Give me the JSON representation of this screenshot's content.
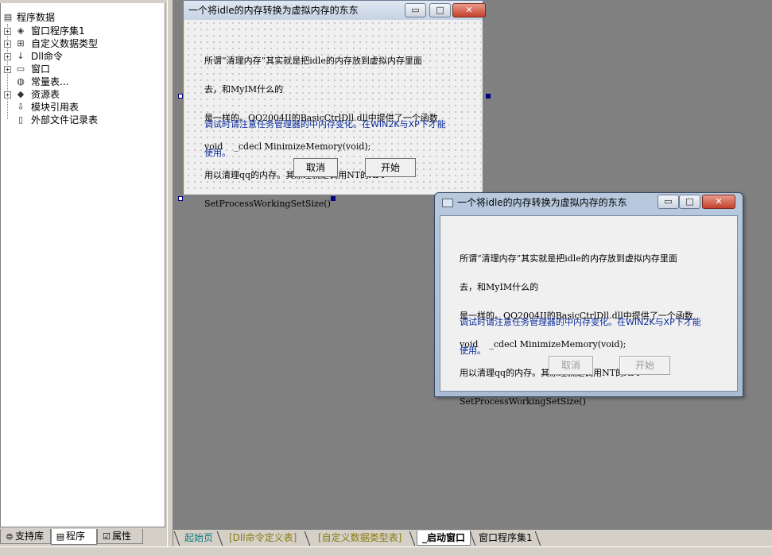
{
  "tree": {
    "root": "程序数据",
    "items": [
      {
        "label": "窗口程序集1",
        "icon": "gear-stack-icon"
      },
      {
        "label": "自定义数据类型",
        "icon": "data-type-icon"
      },
      {
        "label": "Dll命令",
        "icon": "dll-command-icon"
      },
      {
        "label": "窗口",
        "icon": "window-icon"
      },
      {
        "label": "常量表...",
        "icon": "constant-table-icon"
      },
      {
        "label": "资源表",
        "icon": "resource-icon"
      },
      {
        "label": "模块引用表",
        "icon": "module-ref-icon"
      },
      {
        "label": "外部文件记录表",
        "icon": "external-file-icon"
      }
    ]
  },
  "bottom_tabs": [
    {
      "label": "支持库",
      "icon": "library-icon"
    },
    {
      "label": "程序",
      "icon": "program-icon"
    },
    {
      "label": "属性",
      "icon": "property-icon"
    }
  ],
  "design_window": {
    "title": "一个将idle的内存转换为虚拟内存的东东",
    "minimize": "▭",
    "maximize": "□",
    "close": "✕",
    "message_lines": [
      "所谓“清理内存”其实就是把idle的内存放到虚拟内存里面",
      "去，和MyIM什么的",
      "是一样的。QQ2004II的BasicCtrlDll.dll中提供了一个函数",
      "void    _cdecl MinimizeMemory(void);",
      "用以清理qq的内存。其原理就是调用NT的API",
      "SetProcessWorkingSetSize()"
    ],
    "note_lines": [
      "调试时请注意任务管理器的中内存变化。在WIN2K与XP下才能",
      "使用。"
    ],
    "cancel": "取消",
    "start": "开始"
  },
  "preview_window": {
    "title": "一个将idle的内存转换为虚拟内存的东东",
    "message_lines": [
      "所谓“清理内存”其实就是把idle的内存放到虚拟内存里面",
      "去，和MyIM什么的",
      "是一样的。QQ2004II的BasicCtrlDll.dll中提供了一个函数",
      "void    _cdecl MinimizeMemory(void);",
      "用以清理qq的内存。其原理就是调用NT的API",
      "SetProcessWorkingSetSize()"
    ],
    "note_lines": [
      "调试时请注意任务管理器的中内存变化。在WIN2K与XP下才能",
      "使用。"
    ],
    "cancel": "取消",
    "start": "开始"
  },
  "doc_tabs": [
    "起始页",
    "[Dll命令定义表]",
    "[自定义数据类型表]",
    "_启动窗口",
    "窗口程序集1"
  ],
  "colors": {
    "note_text": "#0a2a9a",
    "selection_handle": "#000080"
  }
}
